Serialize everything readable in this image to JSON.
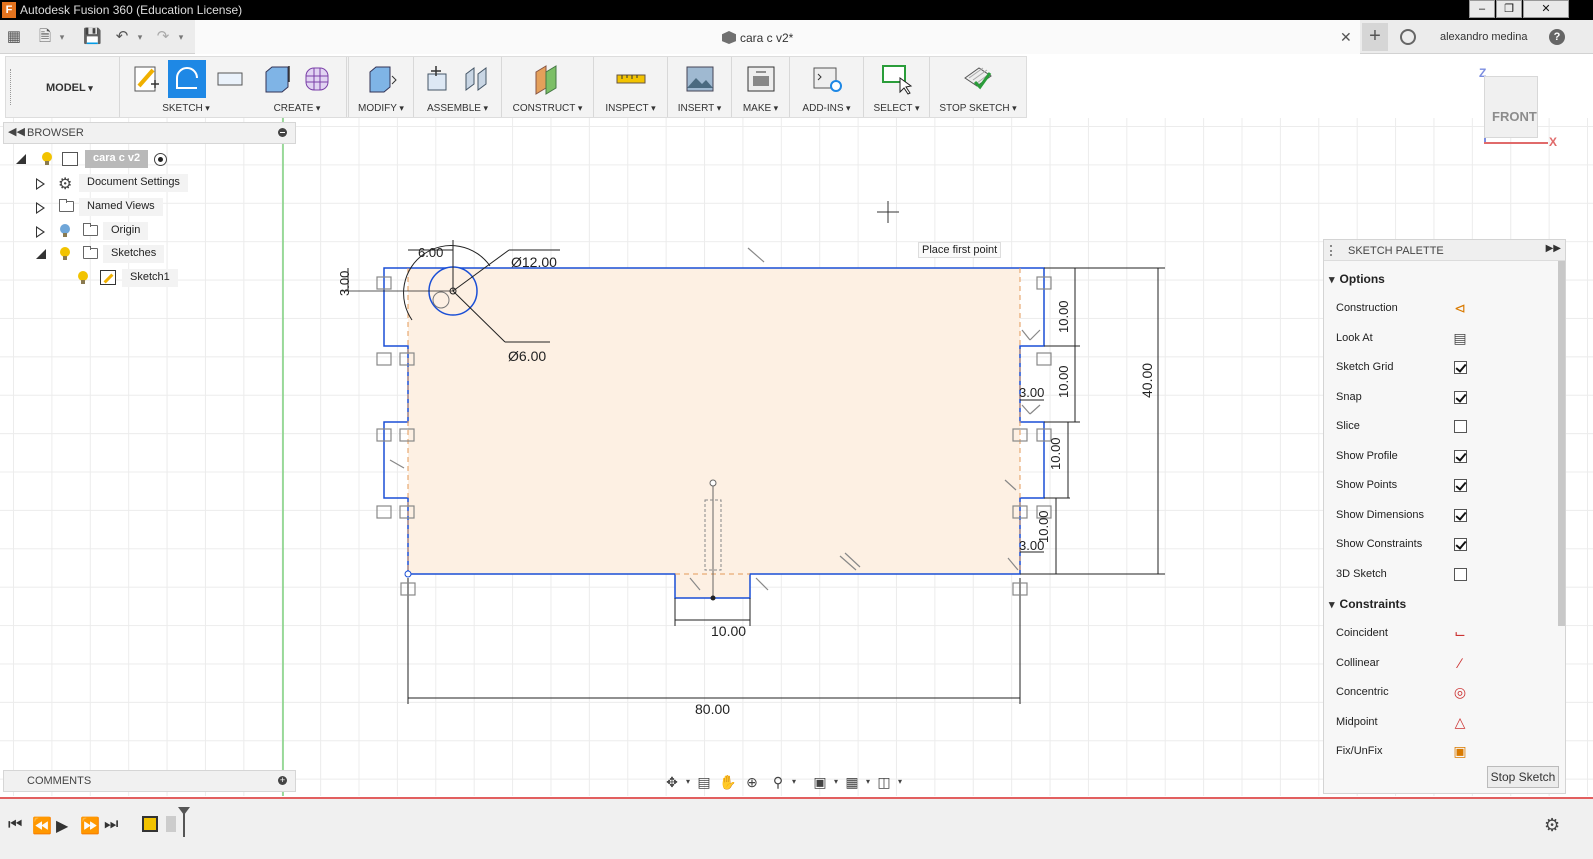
{
  "window": {
    "title": "Autodesk Fusion 360 (Education License)",
    "logo_letter": "F"
  },
  "tabbar": {
    "doc_name": "cara c v2*",
    "user": "alexandro medina",
    "help": "?"
  },
  "toolbar": {
    "workspace": "MODEL",
    "groups": [
      "SKETCH",
      "CREATE",
      "MODIFY",
      "ASSEMBLE",
      "CONSTRUCT",
      "INSPECT",
      "INSERT",
      "MAKE",
      "ADD-INS",
      "SELECT",
      "STOP SKETCH"
    ]
  },
  "browser": {
    "title": "BROWSER",
    "root": "cara c v2",
    "items": [
      "Document Settings",
      "Named Views",
      "Origin",
      "Sketches",
      "Sketch1"
    ]
  },
  "comments": {
    "title": "COMMENTS"
  },
  "viewcube": {
    "face": "FRONT",
    "axis_z": "Z",
    "axis_x": "X"
  },
  "tooltip": "Place first point",
  "dimensions": {
    "hole_large": "Ø12.00",
    "hole_small": "Ø6.00",
    "d_6": "6.00",
    "d_3_left": "3.00",
    "d_10_a": "10.00",
    "d_10_b": "10.00",
    "d_10_c": "10.00",
    "d_10_d": "10.00",
    "d_3_a": "3.00",
    "d_3_b": "3.00",
    "d_40": "40.00",
    "d_10_bottom": "10.00",
    "d_80": "80.00"
  },
  "palette": {
    "title": "SKETCH PALETTE",
    "options_title": "Options",
    "options": [
      {
        "label": "Construction",
        "type": "icon",
        "icon": "construction-icon"
      },
      {
        "label": "Look At",
        "type": "icon",
        "icon": "look-at-icon"
      },
      {
        "label": "Sketch Grid",
        "type": "check",
        "checked": true
      },
      {
        "label": "Snap",
        "type": "check",
        "checked": true
      },
      {
        "label": "Slice",
        "type": "check",
        "checked": false
      },
      {
        "label": "Show Profile",
        "type": "check",
        "checked": true
      },
      {
        "label": "Show Points",
        "type": "check",
        "checked": true
      },
      {
        "label": "Show Dimensions",
        "type": "check",
        "checked": true
      },
      {
        "label": "Show Constraints",
        "type": "check",
        "checked": true
      },
      {
        "label": "3D Sketch",
        "type": "check",
        "checked": false
      }
    ],
    "constraints_title": "Constraints",
    "constraints": [
      {
        "label": "Coincident",
        "icon": "coincident-icon"
      },
      {
        "label": "Collinear",
        "icon": "collinear-icon"
      },
      {
        "label": "Concentric",
        "icon": "concentric-icon"
      },
      {
        "label": "Midpoint",
        "icon": "midpoint-icon"
      },
      {
        "label": "Fix/UnFix",
        "icon": "lock-icon"
      }
    ],
    "stop_button": "Stop Sketch"
  },
  "colors": {
    "sketch_line": "#1a4fd6",
    "profile_fill": "#fdf0e3",
    "accent_blue": "#1e88e5",
    "timeline_line": "#e25f5f"
  }
}
